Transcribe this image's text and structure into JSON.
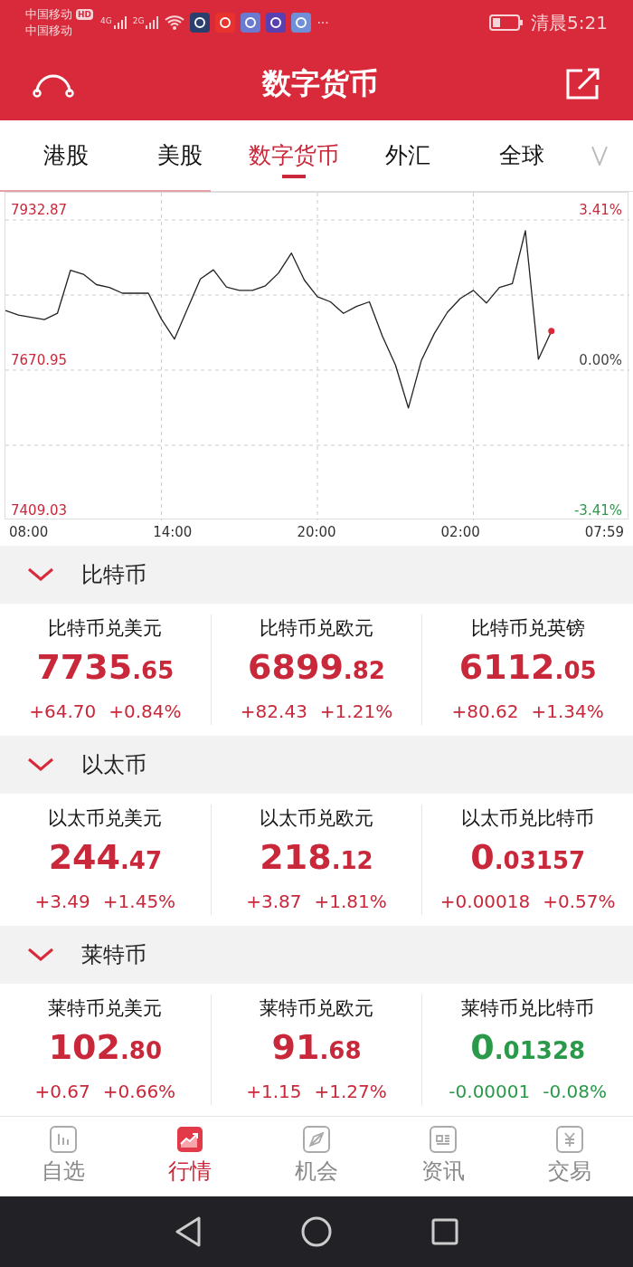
{
  "status_bar": {
    "carrier_1": "中国移动",
    "hd": "HD",
    "carrier_2": "中国移动",
    "net_1": "4G",
    "net_2": "2G",
    "more": "···",
    "time": "清晨5:21"
  },
  "header": {
    "title": "数字货币"
  },
  "tabs": [
    {
      "label": "港股",
      "selected": false
    },
    {
      "label": "美股",
      "selected": false
    },
    {
      "label": "数字货币",
      "selected": true
    },
    {
      "label": "外汇",
      "selected": false
    },
    {
      "label": "全球",
      "selected": false
    }
  ],
  "chart": {
    "right_labels": [
      "3.41%",
      "0.00%",
      "-3.41%"
    ],
    "chart_data": {
      "type": "line",
      "grid": true,
      "ylim": [
        7409.03,
        7932.87
      ],
      "yticks": [
        {
          "value": 7932.87,
          "label": "7932.87"
        },
        {
          "value": 7670.95,
          "label": "7670.95"
        },
        {
          "value": 7409.03,
          "label": "7409.03"
        }
      ],
      "values": [
        7775,
        7767,
        7763,
        7759,
        7770,
        7845,
        7838,
        7820,
        7815,
        7805,
        7805,
        7805,
        7760,
        7725,
        7778,
        7830,
        7846,
        7816,
        7810,
        7810,
        7818,
        7840,
        7875,
        7828,
        7799,
        7790,
        7770,
        7782,
        7790,
        7730,
        7680,
        7605,
        7688,
        7735,
        7772,
        7796,
        7810,
        7788,
        7815,
        7822,
        7914,
        7690,
        7739,
        null,
        null,
        null,
        null,
        null,
        null
      ]
    },
    "time_labels": [
      "08:00",
      "14:00",
      "20:00",
      "02:00",
      "07:59"
    ]
  },
  "sections": [
    {
      "title": "比特币",
      "expanded": true,
      "quotes": [
        {
          "name": "比特币兑美元",
          "price_main": "7735",
          "price_decimal": ".65",
          "change": "+64.70",
          "percent": "+0.84%",
          "color": "#c8283a"
        },
        {
          "name": "比特币兑欧元",
          "price_main": "6899",
          "price_decimal": ".82",
          "change": "+82.43",
          "percent": "+1.21%",
          "color": "#c8283a"
        },
        {
          "name": "比特币兑英镑",
          "price_main": "6112",
          "price_decimal": ".05",
          "change": "+80.62",
          "percent": "+1.34%",
          "color": "#c8283a"
        }
      ]
    },
    {
      "title": "以太币",
      "expanded": true,
      "quotes": [
        {
          "name": "以太币兑美元",
          "price_main": "244",
          "price_decimal": ".47",
          "change": "+3.49",
          "percent": "+1.45%",
          "color": "#c8283a"
        },
        {
          "name": "以太币兑欧元",
          "price_main": "218",
          "price_decimal": ".12",
          "change": "+3.87",
          "percent": "+1.81%",
          "color": "#c8283a"
        },
        {
          "name": "以太币兑比特币",
          "price_main": "0",
          "price_decimal": ".03157",
          "change": "+0.00018",
          "percent": "+0.57%",
          "color": "#c8283a"
        }
      ]
    },
    {
      "title": "莱特币",
      "expanded": true,
      "quotes": [
        {
          "name": "莱特币兑美元",
          "price_main": "102",
          "price_decimal": ".80",
          "change": "+0.67",
          "percent": "+0.66%",
          "color": "#c8283a"
        },
        {
          "name": "莱特币兑欧元",
          "price_main": "91",
          "price_decimal": ".68",
          "change": "+1.15",
          "percent": "+1.27%",
          "color": "#c8283a"
        },
        {
          "name": "莱特币兑比特币",
          "price_main": "0",
          "price_decimal": ".01328",
          "change": "-0.00001",
          "percent": "-0.08%",
          "color": "#2a9a4a"
        }
      ]
    }
  ],
  "bottom_nav": [
    {
      "label": "自选",
      "selected": false
    },
    {
      "label": "行情",
      "selected": true
    },
    {
      "label": "机会",
      "selected": false
    },
    {
      "label": "资讯",
      "selected": false
    },
    {
      "label": "交易",
      "selected": false
    }
  ]
}
